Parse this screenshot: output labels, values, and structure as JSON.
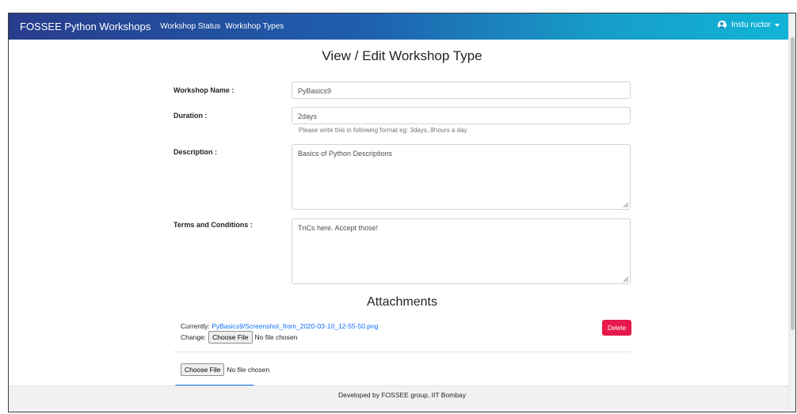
{
  "navbar": {
    "brand": "FOSSEE Python Workshops",
    "links": [
      "Workshop Status",
      "Workshop Types"
    ],
    "user": "Instu ructor"
  },
  "page": {
    "title": "View / Edit Workshop Type"
  },
  "form": {
    "name_label": "Workshop Name :",
    "name_value": "PyBasics9",
    "duration_label": "Duration :",
    "duration_value": "2days",
    "duration_help": "Please write this in following format eg: 3days, 8hours a day",
    "description_label": "Description :",
    "description_value": "Basics of Python Descriptions",
    "terms_label": "Terms and Conditions :",
    "terms_value": "TnCs here. Accept those!"
  },
  "attachments": {
    "title": "Attachments",
    "currently_label": "Currently:",
    "current_file": "PyBasics9/Screenshot_from_2020-03-10_12-55-50.png",
    "change_label": "Change:",
    "choose_label": "Choose File",
    "no_file_text": "No file chosen",
    "delete_label": "Delete",
    "new_choose_label": "Choose File",
    "new_no_file_text": "No file chosen"
  },
  "footer": {
    "text": "Developed by FOSSEE group, IIT Bombay"
  },
  "colors": {
    "nav_start": "#283c8c",
    "nav_end": "#11b5d8",
    "delete": "#e8194b",
    "link": "#0d6efd"
  }
}
